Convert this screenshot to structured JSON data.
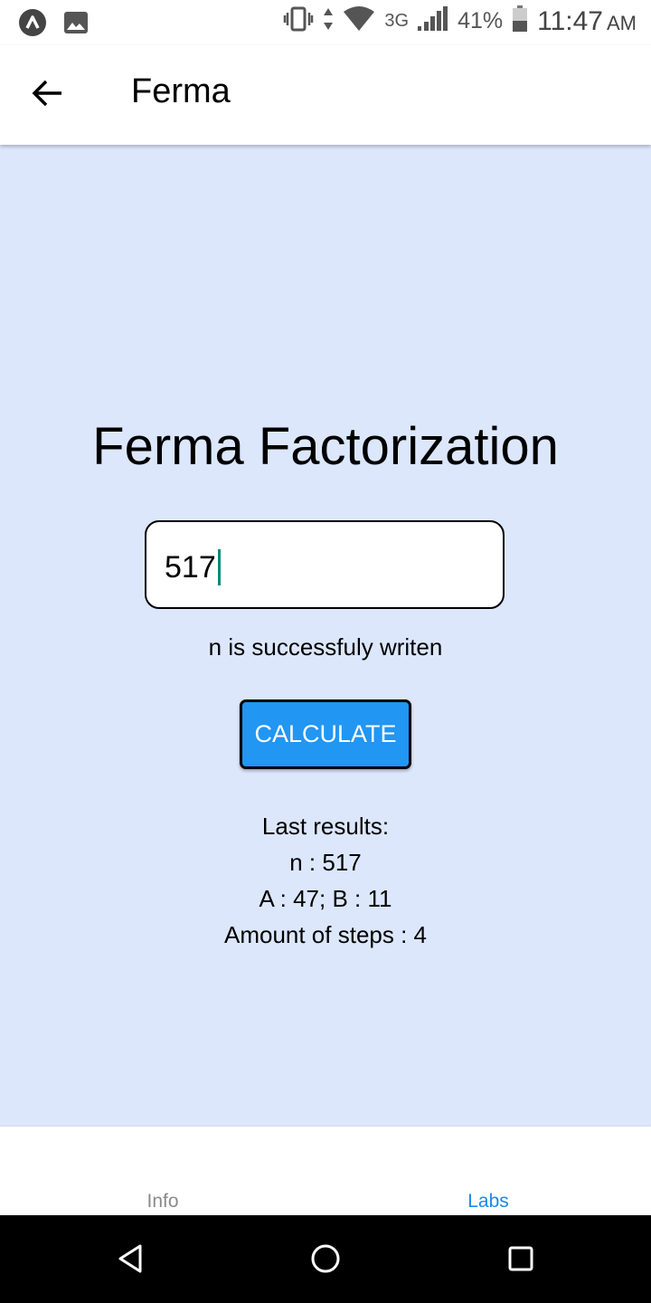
{
  "status_bar": {
    "network": "3G",
    "battery": "41%",
    "time": "11:47",
    "ampm": "AM",
    "icons": [
      "app-notification-icon",
      "image-notification-icon",
      "vibrate-icon",
      "data-arrows-icon",
      "wifi-icon",
      "signal-icon",
      "battery-icon"
    ]
  },
  "app_bar": {
    "title": "Ferma",
    "back_icon": "arrow-back-icon"
  },
  "main": {
    "heading": "Ferma Factorization",
    "input_value": "517",
    "status_message": "n is successfuly writen",
    "calculate_label": "CALCULATE",
    "results": {
      "header": "Last results:",
      "n_line": "n : 517",
      "ab_line": "A : 47; B : 11",
      "steps_line": "Amount of steps : 4"
    }
  },
  "bottom_nav": {
    "tabs": [
      {
        "label": "Info",
        "active": false
      },
      {
        "label": "Labs",
        "active": true
      }
    ]
  },
  "system_nav": [
    "back-icon",
    "home-icon",
    "recents-icon"
  ],
  "colors": {
    "background": "#dce7fc",
    "button": "#2196f3",
    "active_tab": "#1e88e5",
    "caret": "#00897b"
  }
}
